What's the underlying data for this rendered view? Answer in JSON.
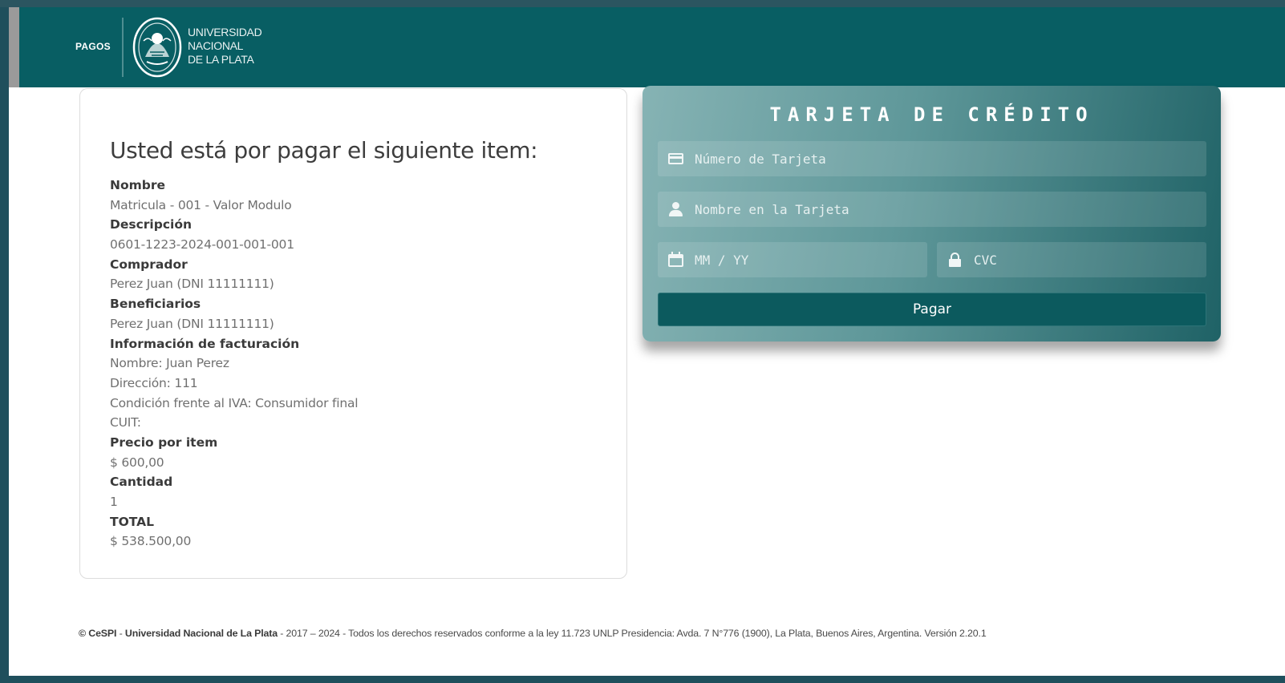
{
  "header": {
    "app_label": "PAGOS",
    "university_line1": "UNIVERSIDAD",
    "university_line2": "NACIONAL",
    "university_line3": "DE LA PLATA"
  },
  "item": {
    "heading": "Usted está por pagar el siguiente item:",
    "fields": [
      {
        "label": "Nombre",
        "values": [
          "Matricula - 001 - Valor Modulo"
        ]
      },
      {
        "label": "Descripción",
        "values": [
          "0601-1223-2024-001-001-001"
        ]
      },
      {
        "label": "Comprador",
        "values": [
          "Perez Juan (DNI 11111111)"
        ]
      },
      {
        "label": "Beneficiarios",
        "values": [
          "Perez Juan (DNI 11111111)"
        ]
      },
      {
        "label": "Información de facturación",
        "values": [
          "Nombre: Juan Perez",
          "Dirección: 111",
          "Condición frente al IVA: Consumidor final",
          "CUIT:"
        ]
      },
      {
        "label": "Precio por item",
        "values": [
          "$ 600,00"
        ]
      },
      {
        "label": "Cantidad",
        "values": [
          "1"
        ]
      },
      {
        "label": "TOTAL",
        "values": [
          "$ 538.500,00"
        ]
      }
    ]
  },
  "card_form": {
    "title": "TARJETA DE CRÉDITO",
    "number_placeholder": "Número de Tarjeta",
    "name_placeholder": "Nombre en la Tarjeta",
    "expiry_placeholder": "MM / YY",
    "cvc_placeholder": "CVC",
    "pay_label": "Pagar"
  },
  "footer": {
    "copyright": "© CeSPI",
    "sep1": " - ",
    "org": "Universidad Nacional de La Plata",
    "rest": " - 2017 – 2024 - Todos los derechos reservados conforme a la ley 11.723 UNLP Presidencia: Avda. 7 N°776 (1900), La Plata, Buenos Aires, Argentina. Versión 2.20.1"
  },
  "colors": {
    "header_bg": "#085e63",
    "card_gradient_start": "#86b3b4",
    "card_gradient_end": "#1f6266",
    "pay_button": "#0c5a5e"
  },
  "icons": [
    "credit-card-icon",
    "user-icon",
    "calendar-icon",
    "lock-icon"
  ]
}
